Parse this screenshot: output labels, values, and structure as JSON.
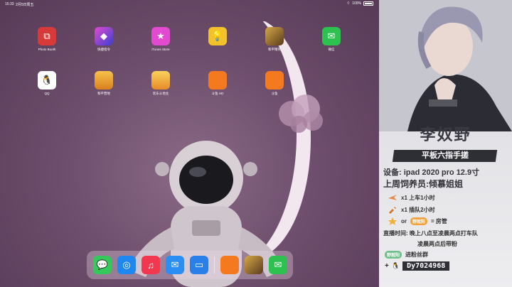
{
  "status_bar": {
    "time": "15:33",
    "date": "2月5日周五",
    "battery": "100%"
  },
  "home_apps": [
    {
      "label": "Photo Booth",
      "glyph": "⧉",
      "color": "#d83a3a"
    },
    {
      "label": "快捷指令",
      "glyph": "◆",
      "color": "#3b3fd1"
    },
    {
      "label": "iTunes Store",
      "glyph": "★",
      "color": "#e24ad0"
    },
    {
      "label": "",
      "glyph": "💡",
      "color": "#f3c12a"
    },
    {
      "label": "和平精英",
      "glyph": "",
      "color": "#8a6a2a"
    },
    {
      "label": "微信",
      "glyph": "✉",
      "color": "#2dc14f"
    },
    {
      "label": "QQ",
      "glyph": "🐧",
      "color": "#ffffff"
    },
    {
      "label": "和平营地",
      "glyph": "",
      "color": "#f0a42a"
    },
    {
      "label": "欢乐斗地主",
      "glyph": "",
      "color": "#f5a623"
    },
    {
      "label": "斗鱼 HD",
      "glyph": "",
      "color": "#f57a1f"
    },
    {
      "label": "斗鱼",
      "glyph": "",
      "color": "#f57a1f"
    }
  ],
  "dock": [
    {
      "name": "messages-app",
      "glyph": "💬",
      "color": "#36c85a"
    },
    {
      "name": "safari-app",
      "glyph": "◎",
      "color": "#1e88f0"
    },
    {
      "name": "music-app",
      "glyph": "♫",
      "color": "#f2384f"
    },
    {
      "name": "mail-app",
      "glyph": "✉",
      "color": "#2a8ef5"
    },
    {
      "name": "files-app",
      "glyph": "▭",
      "color": "#2b7fe8"
    },
    {
      "name": "douyu-app",
      "glyph": "",
      "color": "#f57a1f"
    },
    {
      "name": "pubg-app",
      "glyph": "",
      "color": "#8a6a2a"
    },
    {
      "name": "wechat-app",
      "glyph": "✉",
      "color": "#2dc14f"
    }
  ],
  "panel": {
    "name": "李奴野",
    "banner": "平板六指手搓",
    "device": "设备: ipad 2020 pro 12.9寸",
    "feeder": "上周饲养员:倾慕姐姐",
    "gift_1": "x1 上车1小时",
    "gift_2": "x1 插队2小时",
    "or_text": "or",
    "fan_badge": "野就阳",
    "room_text": "= 房管",
    "time_line_1": "直播时间: 晚上八点至凌晨两点打车队",
    "time_line_2": "凌晨两点后带粉",
    "group_badge": "野就阳",
    "group_text": "进粉丝群",
    "qq_number": "Dy7024968"
  }
}
